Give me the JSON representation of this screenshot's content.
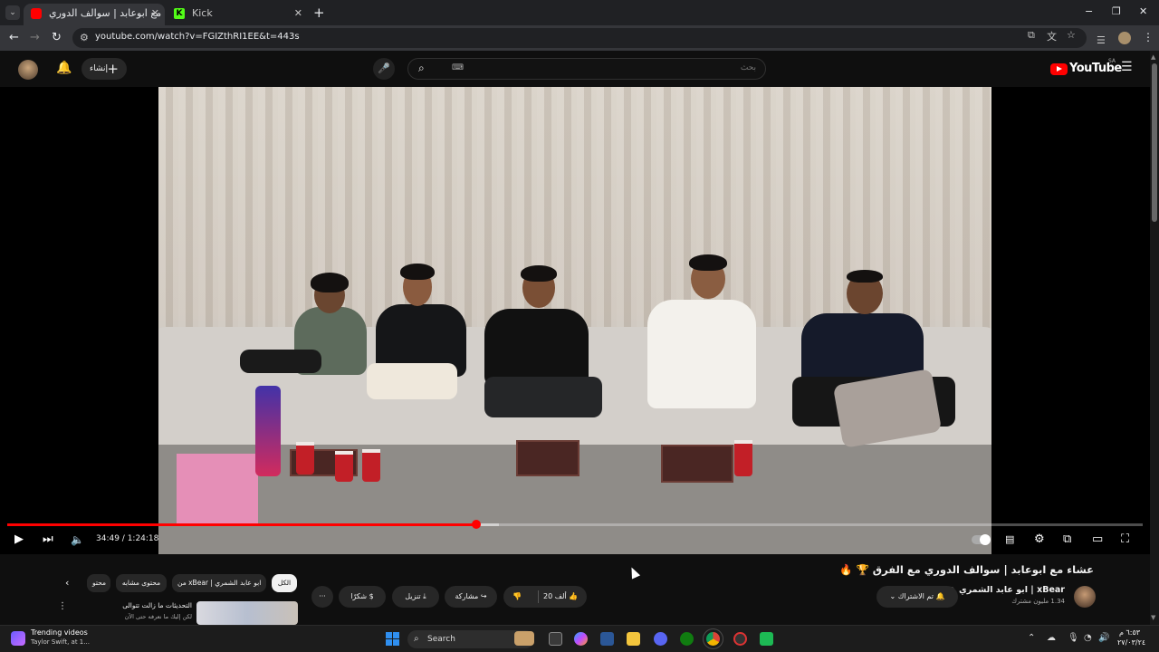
{
  "browser": {
    "tabs": [
      {
        "title": "عشاء مع ابوعابد | سوالف الدوري...",
        "favicon": "youtube-favicon",
        "active": true
      },
      {
        "title": "Kick",
        "favicon": "kick-favicon",
        "active": false
      }
    ],
    "new_tab_label": "+",
    "url": "youtube.com/watch?v=FGIZthRI1EE&t=443s",
    "window_controls": [
      "−",
      "❐",
      "✕"
    ]
  },
  "youtube": {
    "create_label": "إنشاء",
    "search_placeholder": "بحث",
    "logo_text": "YouTube",
    "region": "SA"
  },
  "player": {
    "current_time": "34:49",
    "duration": "1:24:18",
    "progress_fraction": 0.413,
    "buffered_fraction": 0.433,
    "time_label": "34:49 / 1:24:18"
  },
  "video": {
    "title": "عشاء مع ابوعابد | سوالف الدوري مع الفرق 🏆 🔥",
    "channel_name": "xBear | ابو عابد الشمري",
    "subscribers": "1.34 مليون مشترك",
    "subscribed_label": "تم الاشتراك",
    "likes": "20 ألف",
    "share_label": "مشاركة",
    "download_label": "تنزيل",
    "thanks_label": "شكرًا",
    "more_label": "···"
  },
  "chips": {
    "items": [
      "الكل",
      "من xBear | ابو عابد الشمري",
      "محتوى مشابه",
      "محتو"
    ],
    "active_index": 0
  },
  "recommendation": {
    "title": "التحديثات ما زالت تتوالى",
    "subtitle": "لكن إليك ما نعرفه حتى الآن"
  },
  "taskbar": {
    "widget_title": "Trending videos",
    "widget_subtitle": "Taylor Swift, at 1...",
    "search_label": "Search",
    "clock_time": "٦:٥٣ م",
    "clock_date": "٢٧/٠٣/٢٤"
  },
  "colors": {
    "accent_red": "#ff0000",
    "background": "#0f0f0f",
    "chip_bg": "#272727"
  }
}
